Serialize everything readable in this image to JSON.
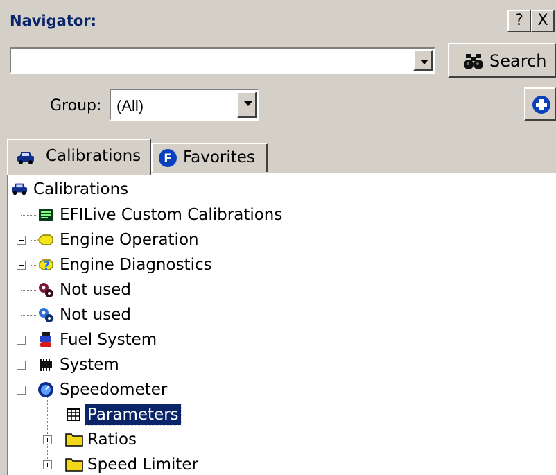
{
  "window": {
    "title": "Navigator:",
    "help_label": "?",
    "close_label": "X"
  },
  "search": {
    "value": "",
    "button_label": "Search"
  },
  "group": {
    "label": "Group:",
    "selected": "(All)"
  },
  "tabs": [
    {
      "label": "Calibrations",
      "icon": "car-icon",
      "active": true
    },
    {
      "label": "Favorites",
      "icon": "favorites-f-icon",
      "active": false
    }
  ],
  "tree": {
    "root": {
      "label": "Calibrations",
      "icon": "car-icon"
    },
    "items": [
      {
        "label": "EFILive Custom Calibrations",
        "icon": "custom-calibrations-icon",
        "expander": "none"
      },
      {
        "label": "Engine Operation",
        "icon": "engine-icon",
        "expander": "plus"
      },
      {
        "label": "Engine Diagnostics",
        "icon": "diagnostics-icon",
        "expander": "plus"
      },
      {
        "label": "Not used",
        "icon": "gears-icon",
        "expander": "none"
      },
      {
        "label": "Not used",
        "icon": "gears-blue-icon",
        "expander": "none"
      },
      {
        "label": "Fuel System",
        "icon": "fuel-system-icon",
        "expander": "plus"
      },
      {
        "label": "System",
        "icon": "chip-icon",
        "expander": "plus"
      },
      {
        "label": "Speedometer",
        "icon": "speedometer-icon",
        "expander": "minus"
      }
    ],
    "speedometer_children": [
      {
        "label": "Parameters",
        "icon": "table-icon",
        "expander": "none",
        "selected": true
      },
      {
        "label": "Ratios",
        "icon": "folder-icon",
        "expander": "plus"
      },
      {
        "label": "Speed Limiter",
        "icon": "folder-icon",
        "expander": "plus"
      }
    ]
  },
  "colors": {
    "title": "#0a246a",
    "selection": "#0a246a",
    "face": "#d4d0c8"
  }
}
